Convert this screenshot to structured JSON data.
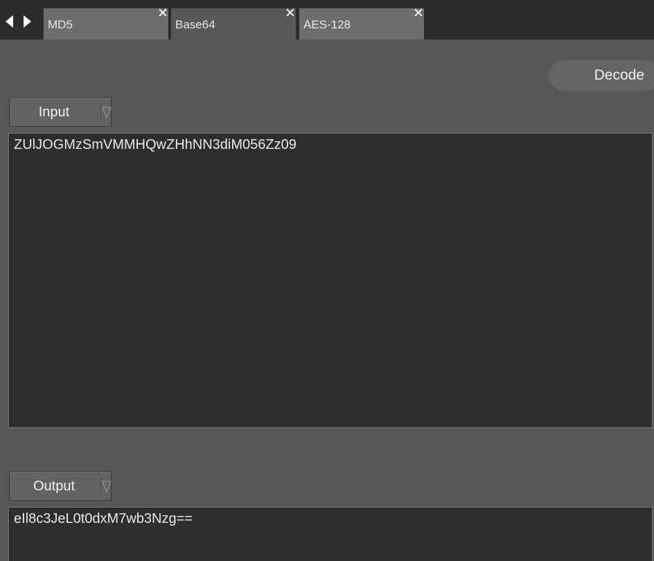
{
  "tabs": [
    {
      "label": "MD5",
      "active": false
    },
    {
      "label": "Base64",
      "active": true
    },
    {
      "label": "AES-128",
      "active": false
    }
  ],
  "tab_close_glyph": "✕",
  "action": {
    "decode_label": "Decode"
  },
  "input": {
    "mode_label": "Input",
    "value": "ZUlJOGMzSmVMMHQwZHhNN3diM056Zz09"
  },
  "output": {
    "mode_label": "Output",
    "value": "eIl8c3JeL0t0dxM7wb3Nzg=="
  },
  "icons": {
    "nav_back": "triangle-left-icon",
    "nav_forward": "triangle-right-icon",
    "tab_close": "close-icon",
    "dropdown": "triangle-down-outline-icon"
  },
  "colors": {
    "tabbar_bg": "#2b2b2b",
    "panel_bg": "#575757",
    "tab_inactive": "#6d6d6d",
    "textbox_bg": "#2e2e2e"
  }
}
